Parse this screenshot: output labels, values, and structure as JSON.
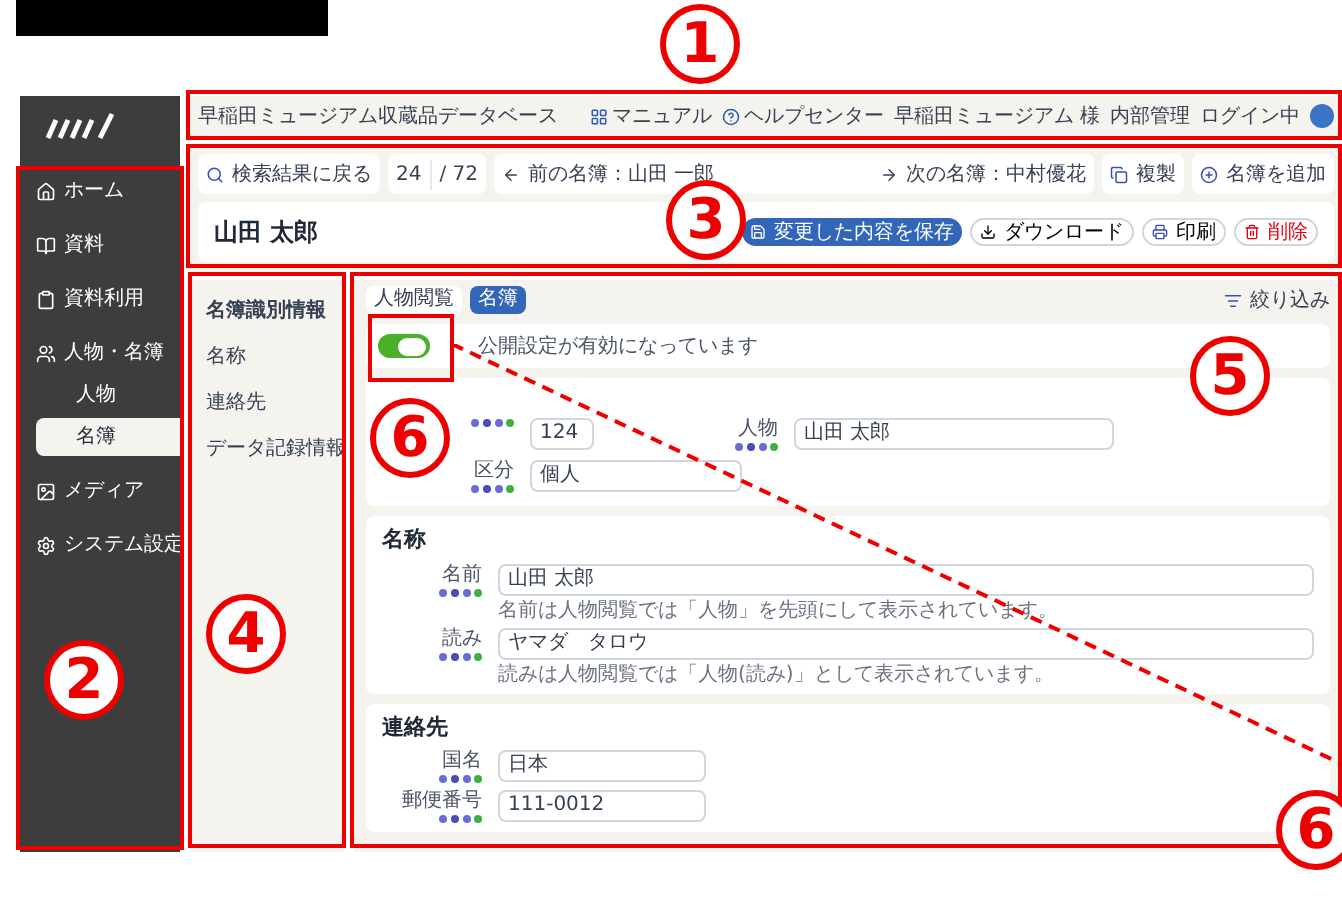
{
  "header": {
    "title": "早稲田ミュージアム収蔵品データベース",
    "links": [
      {
        "label": "マニュアル"
      },
      {
        "label": "ヘルプセンター"
      }
    ],
    "org": "早稲田ミュージアム 様",
    "role": "内部管理",
    "status": "ログイン中"
  },
  "sidebar": {
    "items": [
      {
        "label": "ホーム",
        "selected": false
      },
      {
        "label": "資料",
        "selected": false
      },
      {
        "label": "資料利用",
        "selected": false
      },
      {
        "label": "人物・名簿",
        "selected": false,
        "children": [
          {
            "label": "人物",
            "selected": false
          },
          {
            "label": "名簿",
            "selected": true
          }
        ]
      },
      {
        "label": "メディア",
        "selected": false
      },
      {
        "label": "システム設定",
        "selected": false
      }
    ]
  },
  "toolbar": {
    "back": "検索結果に戻る",
    "page": "24",
    "total": "/ 72",
    "prev": "前の名簿：山田 一郎",
    "next": "次の名簿：中村優花",
    "copy": "複製",
    "add": "名簿を追加"
  },
  "record": {
    "title": "山田 太郎",
    "save": "変更した内容を保存",
    "download": "ダウンロード",
    "print": "印刷",
    "delete": "削除"
  },
  "section_nav": [
    "名簿識別情報",
    "名称",
    "連絡先",
    "データ記録情報"
  ],
  "tabs": [
    {
      "label": "人物閲覧",
      "selected": false
    },
    {
      "label": "名簿",
      "selected": true
    }
  ],
  "filter": "絞り込み",
  "publish": {
    "on": true,
    "label": "公開設定が有効になっています"
  },
  "id_card": {
    "number": "124",
    "person_label": "人物",
    "person": "山田 太郎",
    "type_label": "区分",
    "type": "個人"
  },
  "name_card": {
    "title": "名称",
    "fields": [
      {
        "label": "名前",
        "value": "山田 太郎",
        "help": "名前は人物閲覧では「人物」を先頭にして表示されています。"
      },
      {
        "label": "読み",
        "value": "ヤマダ　タロウ",
        "help": "読みは人物閲覧では「人物(読み)」として表示されています。"
      }
    ]
  },
  "contact_card": {
    "title": "連絡先",
    "fields": [
      {
        "label": "国名",
        "value": "日本"
      },
      {
        "label": "郵便番号",
        "value": "111-0012"
      }
    ]
  },
  "callouts": [
    "1",
    "2",
    "3",
    "4",
    "5",
    "6",
    "6"
  ]
}
